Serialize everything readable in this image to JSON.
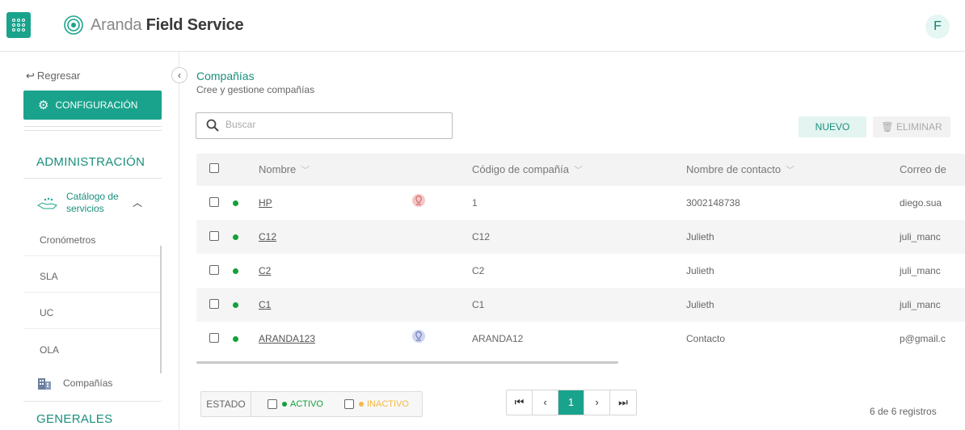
{
  "app": {
    "brand_light": "Aranda",
    "brand_bold": "Field Service",
    "user_initial": "F",
    "accent_color": "#1aa38c"
  },
  "sidebar": {
    "back_label": "Regresar",
    "config_label": "CONFIGURACIÓN",
    "section_admin": "ADMINISTRACIÓN",
    "catalog_line1": "Catálogo de",
    "catalog_line2": "servicios",
    "items": [
      "Cronómetros",
      "SLA",
      "UC",
      "OLA"
    ],
    "companies_label": "Compañías",
    "section_general": "GENERALES"
  },
  "main": {
    "title": "Compañías",
    "subtitle": "Cree y gestione compañías",
    "search_placeholder": "Buscar",
    "new_label": "NUEVO",
    "delete_label": "ELIMINAR"
  },
  "table": {
    "columns": [
      "Nombre",
      "Código de compañía",
      "Nombre de contacto",
      "Correo de"
    ],
    "rows": [
      {
        "name": "HP",
        "code": "1",
        "contact": "3002148738",
        "email": "diego.sua",
        "active": true,
        "pin": "red"
      },
      {
        "name": "C12",
        "code": "C12",
        "contact": "Julieth",
        "email": "juli_manc",
        "active": true,
        "pin": ""
      },
      {
        "name": "C2",
        "code": "C2",
        "contact": "Julieth",
        "email": "juli_manc",
        "active": true,
        "pin": ""
      },
      {
        "name": "C1",
        "code": "C1",
        "contact": "Julieth",
        "email": "juli_manc",
        "active": true,
        "pin": ""
      },
      {
        "name": "ARANDA123",
        "code": "ARANDA12",
        "contact": "Contacto",
        "email": "p@gmail.c",
        "active": true,
        "pin": "blue"
      }
    ]
  },
  "footer": {
    "estado_label": "ESTADO",
    "active_label": "ACTIVO",
    "inactive_label": "INACTIVO",
    "active_color": "#14a03a",
    "inactive_color": "#f5b942",
    "current_page": "1",
    "records_text": "6 de 6 registros"
  }
}
